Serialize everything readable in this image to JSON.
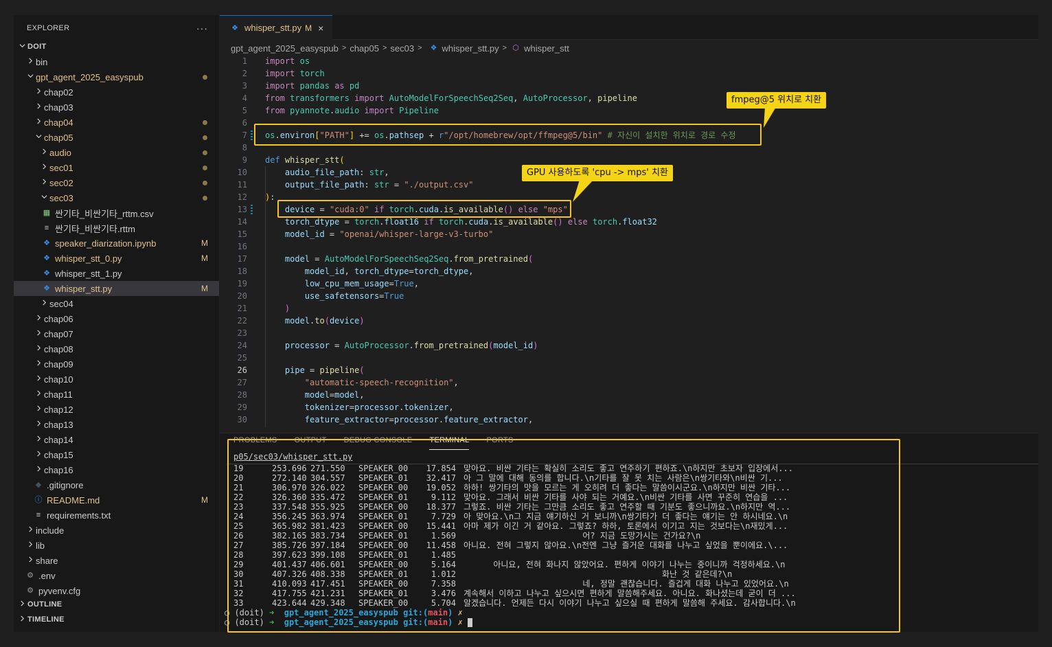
{
  "explorer": {
    "title": "EXPLORER",
    "more": "···",
    "items": [
      {
        "label": "DOIT",
        "kind": "root",
        "level": 0,
        "open": true
      },
      {
        "label": "bin",
        "kind": "folder",
        "level": 1,
        "open": false
      },
      {
        "label": "gpt_agent_2025_easyspub",
        "kind": "folder",
        "level": 1,
        "open": true,
        "modified": true,
        "dot": true
      },
      {
        "label": "chap02",
        "kind": "folder",
        "level": 2,
        "open": false
      },
      {
        "label": "chap03",
        "kind": "folder",
        "level": 2,
        "open": false
      },
      {
        "label": "chap04",
        "kind": "folder",
        "level": 2,
        "open": false,
        "modified": true,
        "dot": true
      },
      {
        "label": "chap05",
        "kind": "folder",
        "level": 2,
        "open": true,
        "modified": true,
        "dot": true
      },
      {
        "label": "audio",
        "kind": "folder",
        "level": 3,
        "open": false,
        "modified": true,
        "dot": true
      },
      {
        "label": "sec01",
        "kind": "folder",
        "level": 3,
        "open": false,
        "modified": true,
        "dot": true
      },
      {
        "label": "sec02",
        "kind": "folder",
        "level": 3,
        "open": false,
        "modified": true,
        "dot": true
      },
      {
        "label": "sec03",
        "kind": "folder",
        "level": 3,
        "open": true,
        "modified": true,
        "dot": true
      },
      {
        "label": "싼기타_비싼기타_rttm.csv",
        "kind": "csv",
        "level": 4
      },
      {
        "label": "싼기타_비싼기타.rttm",
        "kind": "text",
        "level": 4
      },
      {
        "label": "speaker_diarization.ipynb",
        "kind": "notebook",
        "level": 4,
        "modified": true,
        "badge": "M"
      },
      {
        "label": "whisper_stt_0.py",
        "kind": "python",
        "level": 4,
        "modified": true,
        "badge": "M"
      },
      {
        "label": "whisper_stt_1.py",
        "kind": "python",
        "level": 4
      },
      {
        "label": "whisper_stt.py",
        "kind": "python",
        "level": 4,
        "modified": true,
        "badge": "M",
        "selected": true
      },
      {
        "label": "sec04",
        "kind": "folder",
        "level": 3,
        "open": false
      },
      {
        "label": "chap06",
        "kind": "folder",
        "level": 2,
        "open": false
      },
      {
        "label": "chap07",
        "kind": "folder",
        "level": 2,
        "open": false
      },
      {
        "label": "chap08",
        "kind": "folder",
        "level": 2,
        "open": false
      },
      {
        "label": "chap09",
        "kind": "folder",
        "level": 2,
        "open": false
      },
      {
        "label": "chap10",
        "kind": "folder",
        "level": 2,
        "open": false
      },
      {
        "label": "chap11",
        "kind": "folder",
        "level": 2,
        "open": false
      },
      {
        "label": "chap12",
        "kind": "folder",
        "level": 2,
        "open": false
      },
      {
        "label": "chap13",
        "kind": "folder",
        "level": 2,
        "open": false
      },
      {
        "label": "chap14",
        "kind": "folder",
        "level": 2,
        "open": false
      },
      {
        "label": "chap15",
        "kind": "folder",
        "level": 2,
        "open": false
      },
      {
        "label": "chap16",
        "kind": "folder",
        "level": 2,
        "open": false
      },
      {
        "label": ".gitignore",
        "kind": "git",
        "level": 2
      },
      {
        "label": "README.md",
        "kind": "info",
        "level": 2,
        "modified": true,
        "badge": "M"
      },
      {
        "label": "requirements.txt",
        "kind": "text",
        "level": 2
      },
      {
        "label": "include",
        "kind": "folder",
        "level": 1,
        "open": false
      },
      {
        "label": "lib",
        "kind": "folder",
        "level": 1,
        "open": false
      },
      {
        "label": "share",
        "kind": "folder",
        "level": 1,
        "open": false
      },
      {
        "label": ".env",
        "kind": "gear",
        "level": 1
      },
      {
        "label": "pyvenv.cfg",
        "kind": "gear",
        "level": 1
      }
    ],
    "outline": "OUTLINE",
    "timeline": "TIMELINE"
  },
  "tab": {
    "label": "whisper_stt.py",
    "status": "M",
    "close": "×"
  },
  "breadcrumb": [
    "gpt_agent_2025_easyspub",
    "chap05",
    "sec03",
    "whisper_stt.py",
    "whisper_stt"
  ],
  "code": [
    {
      "n": 1,
      "t": [
        [
          "k",
          "import"
        ],
        [
          "p",
          " "
        ],
        [
          "t",
          "os"
        ]
      ]
    },
    {
      "n": 2,
      "t": [
        [
          "k",
          "import"
        ],
        [
          "p",
          " "
        ],
        [
          "t",
          "torch"
        ]
      ]
    },
    {
      "n": 3,
      "t": [
        [
          "k",
          "import"
        ],
        [
          "p",
          " "
        ],
        [
          "t",
          "pandas"
        ],
        [
          "p",
          " "
        ],
        [
          "k",
          "as"
        ],
        [
          "p",
          " "
        ],
        [
          "t",
          "pd"
        ]
      ]
    },
    {
      "n": 4,
      "t": [
        [
          "k",
          "from"
        ],
        [
          "p",
          " "
        ],
        [
          "t",
          "transformers"
        ],
        [
          "p",
          " "
        ],
        [
          "k",
          "import"
        ],
        [
          "p",
          " "
        ],
        [
          "t",
          "AutoModelForSpeechSeq2Seq"
        ],
        [
          "p",
          ", "
        ],
        [
          "t",
          "AutoProcessor"
        ],
        [
          "p",
          ", "
        ],
        [
          "f",
          "pipeline"
        ]
      ]
    },
    {
      "n": 5,
      "t": [
        [
          "k",
          "from"
        ],
        [
          "p",
          " "
        ],
        [
          "t",
          "pyannote"
        ],
        [
          "p",
          "."
        ],
        [
          "t",
          "audio"
        ],
        [
          "p",
          " "
        ],
        [
          "k",
          "import"
        ],
        [
          "p",
          " "
        ],
        [
          "t",
          "Pipeline"
        ]
      ]
    },
    {
      "n": 6,
      "t": []
    },
    {
      "n": 7,
      "mod": true,
      "t": [
        [
          "t",
          "os"
        ],
        [
          "p",
          "."
        ],
        [
          "v",
          "environ"
        ],
        [
          "br1",
          "["
        ],
        [
          "s",
          "\"PATH\""
        ],
        [
          "br1",
          "]"
        ],
        [
          "p",
          " += "
        ],
        [
          "t",
          "os"
        ],
        [
          "p",
          "."
        ],
        [
          "v",
          "pathsep"
        ],
        [
          "p",
          " + "
        ],
        [
          "kb",
          "r"
        ],
        [
          "s",
          "\"/opt/homebrew/opt/ffmpeg@5/bin\""
        ],
        [
          "p",
          " "
        ],
        [
          "c",
          "# 자신이 설치한 위치로 경로 수정"
        ]
      ]
    },
    {
      "n": 8,
      "t": []
    },
    {
      "n": 9,
      "t": [
        [
          "kb",
          "def"
        ],
        [
          "p",
          " "
        ],
        [
          "f",
          "whisper_stt"
        ],
        [
          "br1",
          "("
        ]
      ]
    },
    {
      "n": 10,
      "t": [
        [
          "p",
          "    "
        ],
        [
          "v",
          "audio_file_path"
        ],
        [
          "p",
          ": "
        ],
        [
          "t",
          "str"
        ],
        [
          "p",
          ","
        ]
      ]
    },
    {
      "n": 11,
      "t": [
        [
          "p",
          "    "
        ],
        [
          "v",
          "output_file_path"
        ],
        [
          "p",
          ": "
        ],
        [
          "t",
          "str"
        ],
        [
          "p",
          " = "
        ],
        [
          "s",
          "\"./output.csv\""
        ]
      ]
    },
    {
      "n": 12,
      "t": [
        [
          "br1",
          ")"
        ],
        [
          "p",
          ":"
        ]
      ]
    },
    {
      "n": 13,
      "mod": true,
      "t": [
        [
          "p",
          "    "
        ],
        [
          "v",
          "device"
        ],
        [
          "p",
          " = "
        ],
        [
          "s",
          "\"cuda:0\""
        ],
        [
          "p",
          " "
        ],
        [
          "k",
          "if"
        ],
        [
          "p",
          " "
        ],
        [
          "t",
          "torch"
        ],
        [
          "p",
          "."
        ],
        [
          "v",
          "cuda"
        ],
        [
          "p",
          "."
        ],
        [
          "f",
          "is_available"
        ],
        [
          "br2",
          "()"
        ],
        [
          "p",
          " "
        ],
        [
          "k",
          "else"
        ],
        [
          "p",
          " "
        ],
        [
          "s",
          "\"mps\""
        ]
      ]
    },
    {
      "n": 14,
      "t": [
        [
          "p",
          "    "
        ],
        [
          "v",
          "torch_dtype"
        ],
        [
          "p",
          " = "
        ],
        [
          "t",
          "torch"
        ],
        [
          "p",
          "."
        ],
        [
          "v",
          "float16"
        ],
        [
          "p",
          " "
        ],
        [
          "k",
          "if"
        ],
        [
          "p",
          " "
        ],
        [
          "t",
          "torch"
        ],
        [
          "p",
          "."
        ],
        [
          "v",
          "cuda"
        ],
        [
          "p",
          "."
        ],
        [
          "f",
          "is_available"
        ],
        [
          "br2",
          "()"
        ],
        [
          "p",
          " "
        ],
        [
          "k",
          "else"
        ],
        [
          "p",
          " "
        ],
        [
          "t",
          "torch"
        ],
        [
          "p",
          "."
        ],
        [
          "v",
          "float32"
        ]
      ]
    },
    {
      "n": 15,
      "t": [
        [
          "p",
          "    "
        ],
        [
          "v",
          "model_id"
        ],
        [
          "p",
          " = "
        ],
        [
          "s",
          "\"openai/whisper-large-v3-turbo\""
        ]
      ]
    },
    {
      "n": 16,
      "t": []
    },
    {
      "n": 17,
      "t": [
        [
          "p",
          "    "
        ],
        [
          "v",
          "model"
        ],
        [
          "p",
          " = "
        ],
        [
          "t",
          "AutoModelForSpeechSeq2Seq"
        ],
        [
          "p",
          "."
        ],
        [
          "f",
          "from_pretrained"
        ],
        [
          "br2",
          "("
        ]
      ]
    },
    {
      "n": 18,
      "t": [
        [
          "p",
          "        "
        ],
        [
          "v",
          "model_id"
        ],
        [
          "p",
          ", "
        ],
        [
          "v",
          "torch_dtype"
        ],
        [
          "p",
          "="
        ],
        [
          "v",
          "torch_dtype"
        ],
        [
          "p",
          ","
        ]
      ]
    },
    {
      "n": 19,
      "t": [
        [
          "p",
          "        "
        ],
        [
          "v",
          "low_cpu_mem_usage"
        ],
        [
          "p",
          "="
        ],
        [
          "kb",
          "True"
        ],
        [
          "p",
          ","
        ]
      ]
    },
    {
      "n": 20,
      "t": [
        [
          "p",
          "        "
        ],
        [
          "v",
          "use_safetensors"
        ],
        [
          "p",
          "="
        ],
        [
          "kb",
          "True"
        ]
      ]
    },
    {
      "n": 21,
      "t": [
        [
          "p",
          "    "
        ],
        [
          "br2",
          ")"
        ]
      ]
    },
    {
      "n": 22,
      "t": [
        [
          "p",
          "    "
        ],
        [
          "v",
          "model"
        ],
        [
          "p",
          "."
        ],
        [
          "f",
          "to"
        ],
        [
          "br2",
          "("
        ],
        [
          "v",
          "device"
        ],
        [
          "br2",
          ")"
        ]
      ]
    },
    {
      "n": 23,
      "t": []
    },
    {
      "n": 24,
      "t": [
        [
          "p",
          "    "
        ],
        [
          "v",
          "processor"
        ],
        [
          "p",
          " = "
        ],
        [
          "t",
          "AutoProcessor"
        ],
        [
          "p",
          "."
        ],
        [
          "f",
          "from_pretrained"
        ],
        [
          "br2",
          "("
        ],
        [
          "v",
          "model_id"
        ],
        [
          "br2",
          ")"
        ]
      ]
    },
    {
      "n": 25,
      "t": []
    },
    {
      "n": 26,
      "active": true,
      "t": [
        [
          "p",
          "    "
        ],
        [
          "v",
          "pipe"
        ],
        [
          "p",
          " = "
        ],
        [
          "f",
          "pipeline"
        ],
        [
          "br2",
          "("
        ]
      ]
    },
    {
      "n": 27,
      "t": [
        [
          "p",
          "        "
        ],
        [
          "s",
          "\"automatic-speech-recognition\""
        ],
        [
          "p",
          ","
        ]
      ]
    },
    {
      "n": 28,
      "t": [
        [
          "p",
          "        "
        ],
        [
          "v",
          "model"
        ],
        [
          "p",
          "="
        ],
        [
          "v",
          "model"
        ],
        [
          "p",
          ","
        ]
      ]
    },
    {
      "n": 29,
      "t": [
        [
          "p",
          "        "
        ],
        [
          "v",
          "tokenizer"
        ],
        [
          "p",
          "="
        ],
        [
          "v",
          "processor"
        ],
        [
          "p",
          "."
        ],
        [
          "v",
          "tokenizer"
        ],
        [
          "p",
          ","
        ]
      ]
    },
    {
      "n": 30,
      "t": [
        [
          "p",
          "        "
        ],
        [
          "v",
          "feature_extractor"
        ],
        [
          "p",
          "="
        ],
        [
          "v",
          "processor"
        ],
        [
          "p",
          "."
        ],
        [
          "v",
          "feature_extractor"
        ],
        [
          "p",
          ","
        ]
      ]
    }
  ],
  "callouts": {
    "ffmpeg": "fmpeg@5 위치로 치환",
    "gpu": "GPU 사용하도록 'cpu -> mps' 치환"
  },
  "panel": {
    "tabs": [
      "PROBLEMS",
      "OUTPUT",
      "DEBUG CONSOLE",
      "TERMINAL",
      "PORTS"
    ],
    "active_tab": "TERMINAL",
    "path": "p05/sec03/whisper_stt.py",
    "rows": [
      [
        "19",
        "253.696",
        "271.550",
        "SPEAKER_00",
        "17.854",
        "맞아요. 비싼 기타는 확실히 소리도 좋고 연주하기 편하죠.\\n하지만 초보자 입장에서..."
      ],
      [
        "20",
        "272.140",
        "304.557",
        "SPEAKER_01",
        "32.417",
        "아 그 말에 대해 동의를 합니다.\\n기타를 잘 못 치는 사람은\\n쌍기타와\\n비싼 기..."
      ],
      [
        "21",
        "306.970",
        "326.022",
        "SPEAKER_00",
        "19.052",
        "하하! 쌍기타의 맛을 모르는 게 오히려 더 좋다는 말씀이시군요.\\n하지만 비싼 기타..."
      ],
      [
        "22",
        "326.360",
        "335.472",
        "SPEAKER_01",
        "9.112",
        "맞아요. 그래서 비싼 기타를 사야 되는 거예요.\\n비싼 기타를 사면 꾸준히 연습을 ..."
      ],
      [
        "23",
        "337.548",
        "355.925",
        "SPEAKER_00",
        "18.377",
        "그렇죠. 비싼 기타는 그만큼 소리도 좋고 연주할 때 기분도 좋으니까요.\\n하지만 역..."
      ],
      [
        "24",
        "356.245",
        "363.974",
        "SPEAKER_01",
        "7.729",
        "아 맞아요.\\n그 지금 얘기하신 거 보니까\\n쌍기타가 더 좋다는 얘기는 안 하시네요.\\n"
      ],
      [
        "25",
        "365.982",
        "381.423",
        "SPEAKER_00",
        "15.441",
        "아마 제가 이긴 거 같아요. 그렇죠? 하하, 토론에서 이기고 지는 것보다는\\n재밌게..."
      ],
      [
        "26",
        "382.165",
        "383.734",
        "SPEAKER_01",
        "1.569",
        "                        어? 지금 도망가시는 건가요?\\n"
      ],
      [
        "27",
        "385.726",
        "397.184",
        "SPEAKER_00",
        "11.458",
        "아니요. 전혀 그렇지 않아요.\\n전엔 그냥 즐거운 대화를 나누고 싶었을 뿐이에요.\\..."
      ],
      [
        "28",
        "397.623",
        "399.108",
        "SPEAKER_01",
        "1.485",
        ""
      ],
      [
        "29",
        "401.437",
        "406.601",
        "SPEAKER_00",
        "5.164",
        "      아니요, 전혀 화나지 않았어요. 편하게 이야기 나누는 중이니까 걱정하세요.\\n"
      ],
      [
        "30",
        "407.326",
        "408.338",
        "SPEAKER_01",
        "1.012",
        "                                        화난 것 같은데?\\n"
      ],
      [
        "31",
        "410.093",
        "417.451",
        "SPEAKER_00",
        "7.358",
        "                        네, 정말 괜찮습니다. 즐겁게 대화 나누고 있었어요.\\n"
      ],
      [
        "32",
        "417.755",
        "421.231",
        "SPEAKER_01",
        "3.476",
        "계속해서 이하고 나누고 싶으시면 편하게 말씀해주세요. 아니요. 화나셨는데 굳이 더 ..."
      ],
      [
        "33",
        "423.644",
        "429.348",
        "SPEAKER_00",
        "5.704",
        "알겠습니다. 언제든 다시 이야기 나누고 싶으실 때 편하게 말씀해 주세요. 감사합니다.\\n"
      ]
    ],
    "prompts": [
      {
        "env": "(doit)",
        "arrow": "➜",
        "dir": "gpt_agent_2025_easyspub",
        "git": "git:",
        "lp": "(",
        "branch": "main",
        "rp": ")",
        "x": "✗"
      },
      {
        "env": "(doit)",
        "arrow": "➜",
        "dir": "gpt_agent_2025_easyspub",
        "git": "git:",
        "lp": "(",
        "branch": "main",
        "rp": ")",
        "x": "✗"
      }
    ]
  }
}
